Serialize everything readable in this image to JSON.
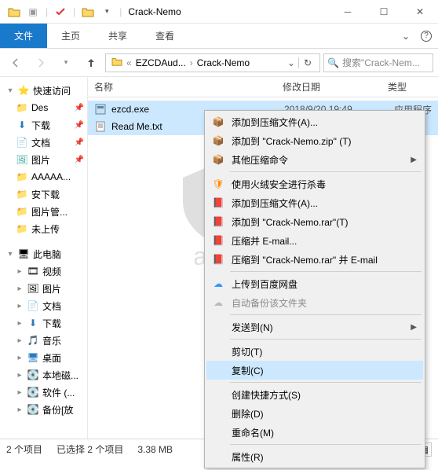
{
  "title": "Crack-Nemo",
  "ribbon": {
    "file": "文件",
    "home": "主页",
    "share": "共享",
    "view": "查看"
  },
  "breadcrumb": {
    "b1": "EZCDAud...",
    "b2": "Crack-Nemo"
  },
  "search_placeholder": "搜索\"Crack-Nem...",
  "cols": {
    "name": "名称",
    "date": "修改日期",
    "type": "类型"
  },
  "nav": {
    "quick": "快速访问",
    "des": "Des",
    "downloads": "下载",
    "docs": "文档",
    "pics": "图片",
    "aaaa": "AAAAA...",
    "axia": "安下载",
    "pic_admin": "图片管...",
    "not_up": "未上传",
    "pc": "此电脑",
    "video": "视频",
    "pics2": "图片",
    "docs2": "文档",
    "downloads2": "下载",
    "music": "音乐",
    "desk": "桌面",
    "localc": "本地磁...",
    "soft": "软件 (...",
    "bak": "备份[放"
  },
  "files": {
    "f1": {
      "name": "ezcd.exe",
      "date": "2018/9/20 19:49",
      "type": "应用程序"
    },
    "f2": {
      "name": "Read Me.txt"
    }
  },
  "ctx": {
    "add_arch": "添加到压缩文件(A)...",
    "add_zip": "添加到 \"Crack-Nemo.zip\" (T)",
    "other_zip": "其他压缩命令",
    "huorong": "使用火绒安全进行杀毒",
    "add_arch2": "添加到压缩文件(A)...",
    "add_rar": "添加到 \"Crack-Nemo.rar\"(T)",
    "compress_email": "压缩并 E-mail...",
    "compress_rar_email": "压缩到 \"Crack-Nemo.rar\" 并 E-mail",
    "baidu": "上传到百度网盘",
    "autobackup": "自动备份该文件夹",
    "sendto": "发送到(N)",
    "cut": "剪切(T)",
    "copy": "复制(C)",
    "shortcut": "创建快捷方式(S)",
    "delete": "删除(D)",
    "rename": "重命名(M)",
    "props": "属性(R)"
  },
  "status": {
    "items": "2 个项目",
    "sel": "已选择 2 个项目",
    "size": "3.38 MB"
  },
  "wm": "anz"
}
